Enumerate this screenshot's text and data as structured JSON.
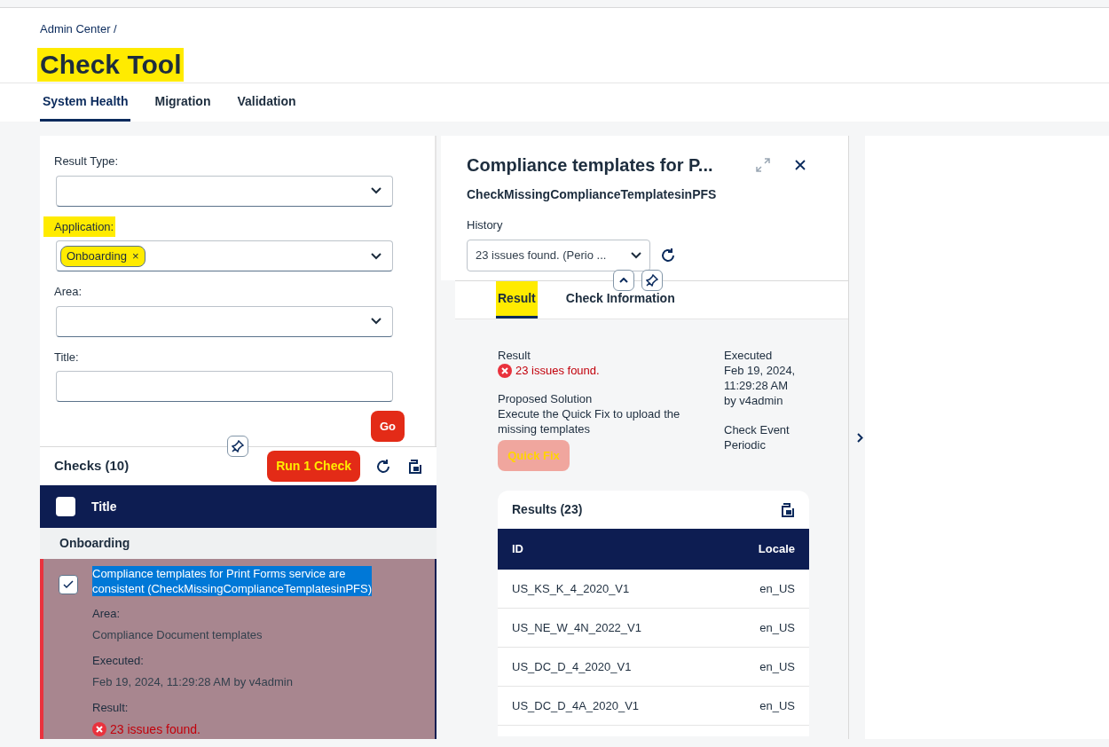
{
  "breadcrumb": "Admin Center /",
  "page_title": {
    "text": "Check Tool",
    "highlighted": true
  },
  "tabs": [
    {
      "label": "System Health",
      "selected": true
    },
    {
      "label": "Migration",
      "selected": false
    },
    {
      "label": "Validation",
      "selected": false
    }
  ],
  "filters": [
    {
      "label": "Result Type:",
      "kind": "select",
      "highlighted": false
    },
    {
      "label": "Application:",
      "kind": "select",
      "highlighted": true,
      "tokens": [
        {
          "text": "Onboarding",
          "remove": "×",
          "highlighted": true
        }
      ]
    },
    {
      "label": "Area:",
      "kind": "select",
      "highlighted": false
    },
    {
      "label": "Title:",
      "kind": "text",
      "highlighted": false
    }
  ],
  "go_button": "Go",
  "checks": {
    "title": "Checks (10)",
    "run_button": {
      "label": "Run 1 Check",
      "highlighted": true
    },
    "column": "Title",
    "select_all": false,
    "group": "Onboarding",
    "rows": [
      {
        "checked": true,
        "title": "Compliance templates for Print Forms service are consistent (CheckMissingComplianceTemplatesinPFS)",
        "text_selected": true,
        "fields": [
          {
            "label": "Area:",
            "value": "Compliance Document templates",
            "kind": "text"
          },
          {
            "label": "Executed:",
            "value": "Feb 19, 2024, 11:29:28 AM by v4admin",
            "kind": "text"
          },
          {
            "label": "Result:",
            "value": "23 issues found.",
            "kind": "error"
          }
        ]
      }
    ]
  },
  "detail": {
    "title": "Compliance templates for P...",
    "subtitle": "CheckMissingComplianceTemplatesinPFS",
    "history_label": "History",
    "history_value": "23 issues found. (Perio ...",
    "tabs": [
      {
        "label": "Result",
        "selected": true,
        "highlighted": true
      },
      {
        "label": "Check Information",
        "selected": false,
        "highlighted": false
      }
    ],
    "result_label": "Result",
    "result_value": "23 issues found.",
    "solution_label": "Proposed Solution",
    "solution_text": "Execute the Quick Fix to upload the missing templates",
    "quick_fix": {
      "label": "Quick Fix",
      "highlighted": true
    },
    "executed_label": "Executed",
    "executed_value": "Feb 19, 2024, 11:29:28 AM by v4admin",
    "event_label": "Check Event",
    "event_value": "Periodic",
    "results": {
      "title": "Results (23)",
      "columns": [
        "ID",
        "Locale"
      ],
      "rows": [
        [
          "US_KS_K_4_2020_V1",
          "en_US"
        ],
        [
          "US_NE_W_4N_2022_V1",
          "en_US"
        ],
        [
          "US_DC_D_4_2020_V1",
          "en_US"
        ],
        [
          "US_DC_D_4A_2020_V1",
          "en_US"
        ]
      ]
    }
  }
}
